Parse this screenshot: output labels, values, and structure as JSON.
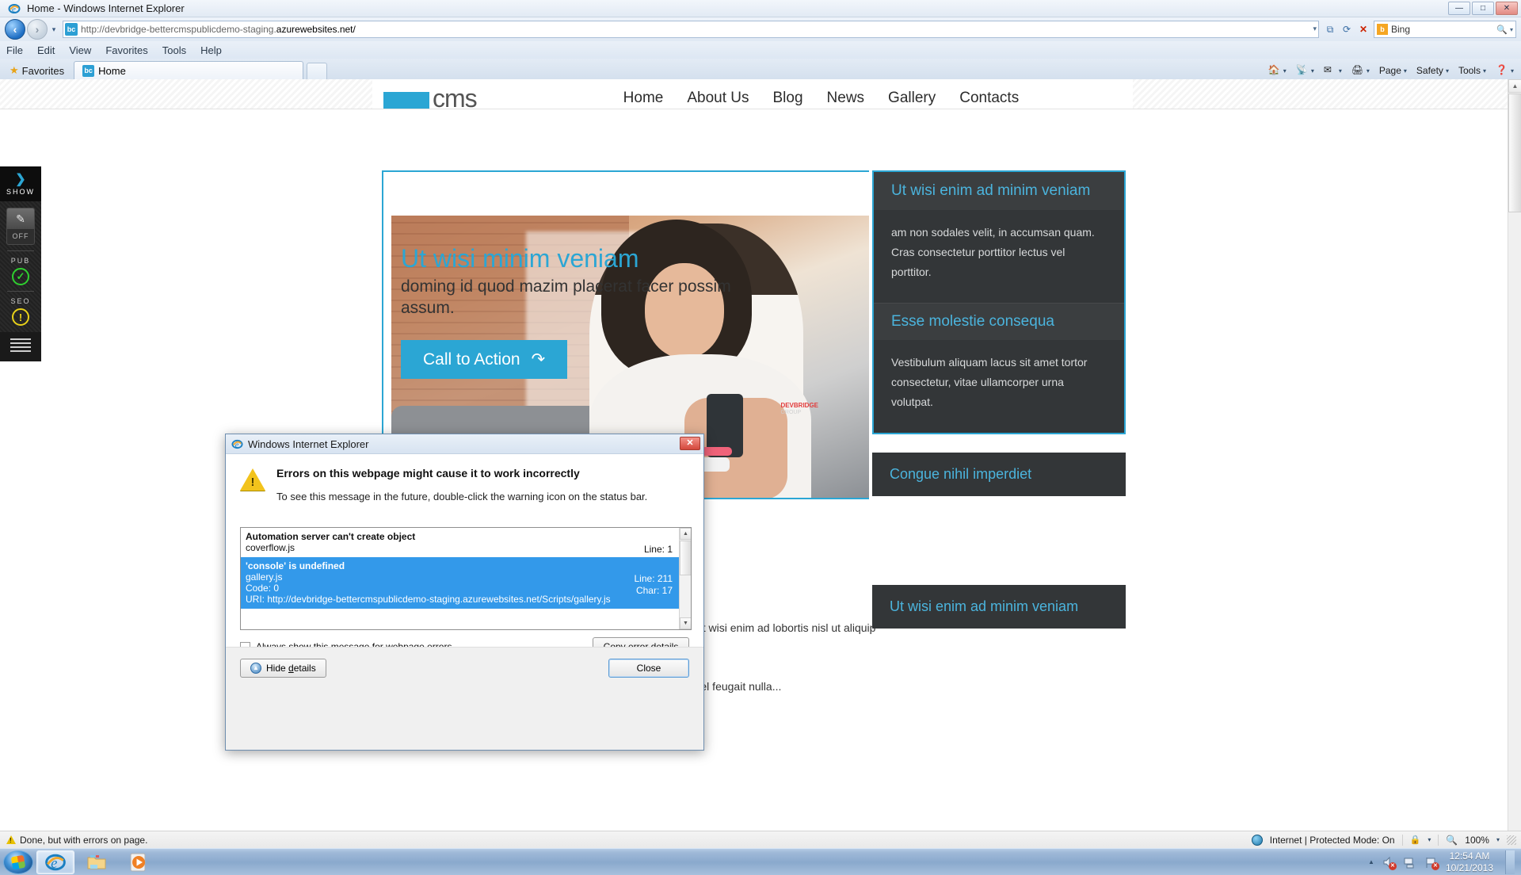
{
  "browser": {
    "window_title": "Home - Windows Internet Explorer",
    "window_buttons": {
      "minimize": "—",
      "maximize": "□",
      "close": "✕"
    },
    "address": {
      "protocol_host": "http://devbridge-bettercmspublicdemo-staging.",
      "domain_bold": "azurewebsites.net/",
      "favicon_label": "bc"
    },
    "menu": [
      "File",
      "Edit",
      "View",
      "Favorites",
      "Tools",
      "Help"
    ],
    "favorites_label": "Favorites",
    "tab": {
      "label": "Home",
      "favicon_label": "bc"
    },
    "command_bar": [
      "Page",
      "Safety",
      "Tools"
    ],
    "search": {
      "value": "Bing",
      "engine_logo": "b"
    }
  },
  "cms_sidebar": {
    "show_label": "SHOW",
    "edit_toggle_label": "OFF",
    "pub_label": "PUB",
    "pub_status": "✓",
    "seo_label": "SEO",
    "seo_status": "!"
  },
  "site": {
    "logo_text": "cms",
    "nav": [
      "Home",
      "About Us",
      "Blog",
      "News",
      "Gallery",
      "Contacts"
    ],
    "hero": {
      "heading": "Ut wisi minim veniam",
      "paragraph": "doming id quod mazim placerat facer possim assum.",
      "cta_label": "Call to Action",
      "cta_icon": "↷",
      "photo_watermark": "DEVBRIDGE",
      "photo_watermark_sub": "GROUP"
    },
    "widgets": [
      {
        "title": "Ut wisi enim ad minim veniam",
        "body": "am non sodales velit, in accumsan quam. Cras consectetur porttitor lectus vel porttitor.",
        "sub_title": "Esse molestie consequa",
        "sub_body": "Vestibulum aliquam lacus sit amet tortor consectetur, vitae ullamcorper urna volutpat."
      },
      {
        "title": "Congue nihil imperdiet"
      },
      {
        "title": "Ut wisi enim ad minim veniam"
      }
    ],
    "body_paragraphs": [
      "d diamnonummy nibh utpat. Ut wisi enim ad lobortis nisl ut aliquip ex i.",
      "llamcorper suscipit di autem vel feugait nulla..."
    ]
  },
  "dialog": {
    "title": "Windows Internet Explorer",
    "close_glyph": "✕",
    "heading": "Errors on this webpage might cause it to work incorrectly",
    "subtext": "To see this message in the future, double-click the warning icon on the status bar.",
    "errors": [
      {
        "title": "Automation server can't create object",
        "file": "coverflow.js",
        "line": "Line: 1",
        "char": "",
        "code": "",
        "uri": "",
        "selected": false
      },
      {
        "title": "'console' is undefined",
        "file": "gallery.js",
        "line": "Line: 211",
        "char": "Char: 17",
        "code": "Code: 0",
        "uri": "URI: http://devbridge-bettercmspublicdemo-staging.azurewebsites.net/Scripts/gallery.js",
        "selected": true
      }
    ],
    "checkbox_label_pre": "A",
    "checkbox_label": "lways show this message for webpage errors",
    "copy_button_pre": "C",
    "copy_button": "opy error details",
    "hide_button_pre": "Hide ",
    "hide_button_accel": "d",
    "hide_button_post": "etails",
    "close_button": "Close"
  },
  "status_bar": {
    "message": "Done, but with errors on page.",
    "zone": "Internet | Protected Mode: On",
    "zoom": "100%"
  },
  "taskbar": {
    "items": [
      "internet-explorer",
      "windows-explorer",
      "media-player"
    ],
    "clock_time": "12:54 AM",
    "clock_date": "10/21/2013"
  },
  "colors": {
    "accent": "#2ba6d4",
    "panel_dark": "#333638",
    "selection": "#3399ea"
  }
}
